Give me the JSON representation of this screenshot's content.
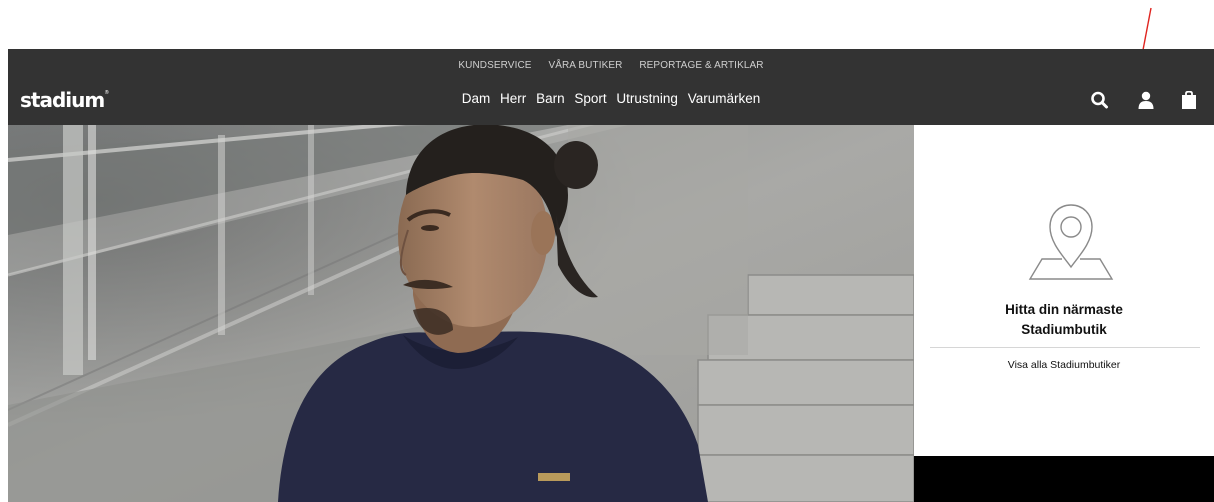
{
  "header": {
    "top_links": [
      "KUNDSERVICE",
      "VÅRA BUTIKER",
      "REPORTAGE & ARTIKLAR"
    ],
    "logo": "stadium",
    "logo_mark": "®",
    "nav": [
      "Dam",
      "Herr",
      "Barn",
      "Sport",
      "Utrustning",
      "Varumärken"
    ],
    "icons": [
      "search-icon",
      "account-icon",
      "shopping-bag-icon"
    ]
  },
  "hero": {
    "image": "man-in-navy-tshirt-sitting-on-concrete-steps"
  },
  "store_finder": {
    "icon": "map-pin-icon",
    "title_line1": "Hitta din närmaste",
    "title_line2": "Stadiumbutik",
    "link": "Visa alla Stadiumbutiker"
  },
  "colors": {
    "header_bg": "#333333",
    "annotation": "#e0241f",
    "shirt": "#262944"
  }
}
